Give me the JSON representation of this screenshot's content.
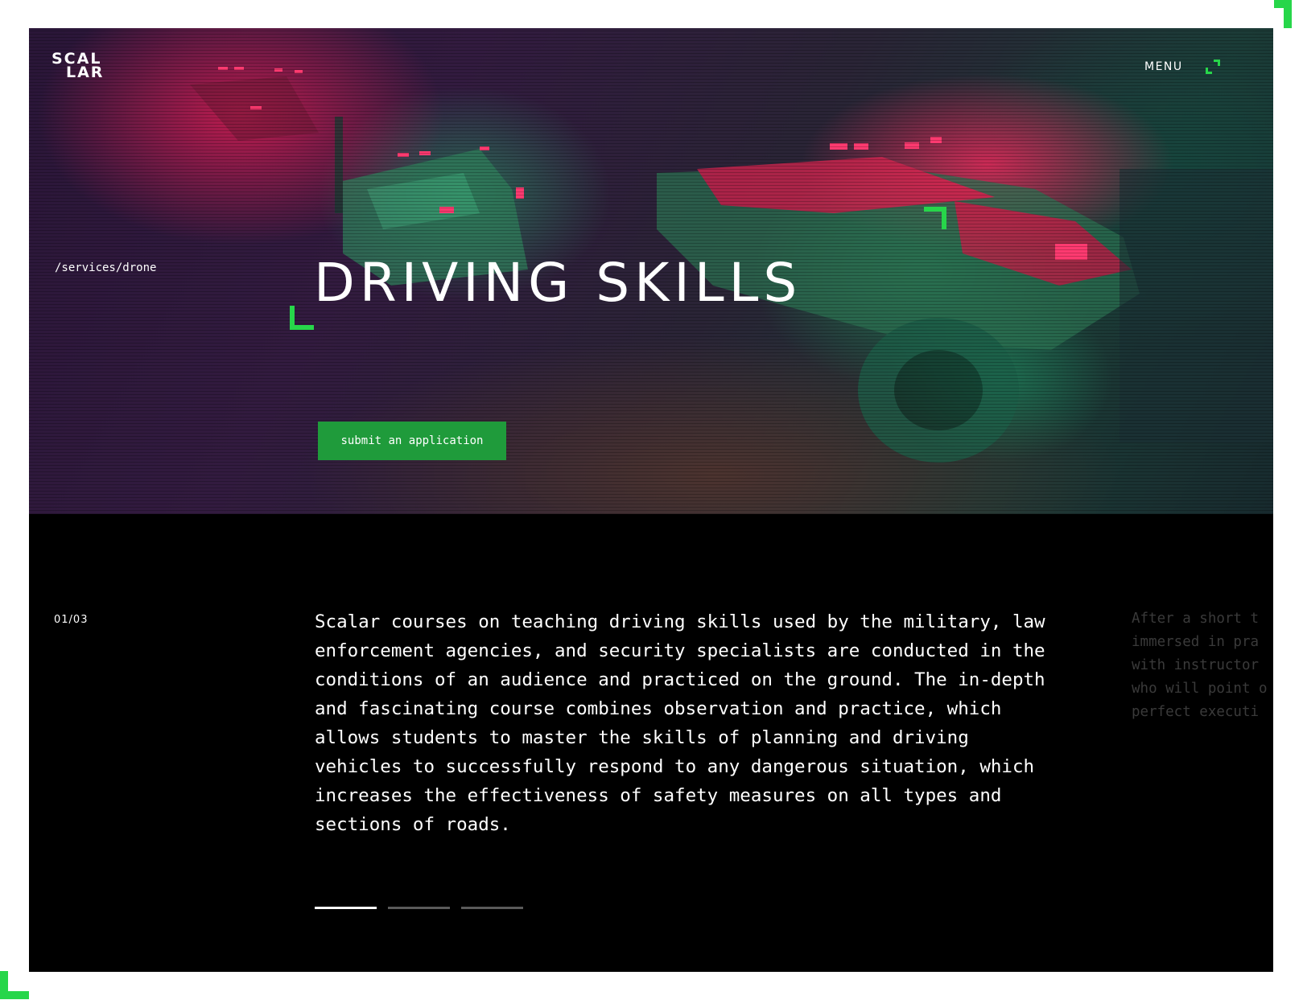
{
  "header": {
    "logo_line1": "SCAL",
    "logo_line2": "LAR",
    "menu_label": "MENU"
  },
  "hero": {
    "breadcrumb": "/services/drone",
    "title": "DRIVING SKILLS",
    "cta_label": "submit an application"
  },
  "content": {
    "counter": "01/03",
    "description": "Scalar courses on teaching driving skills used by the military, law enforcement agencies, and security specialists are conducted in the conditions of an audience and practiced on the ground. The in-depth and fascinating course combines observation and practice, which allows students to master the skills of planning and driving vehicles to successfully respond to any dangerous situation, which increases the effectiveness of safety measures on all types and sections of roads.",
    "next_preview": "After a short t\nimmersed in pra\nwith instructor\nwho will point o\nperfect executi"
  },
  "pagination": {
    "total": 3,
    "active_index": 0
  },
  "colors": {
    "accent_green": "#27d64a",
    "button_green": "#1f9b3b",
    "hero_red": "#e8285a",
    "hero_teal": "#247850"
  },
  "icons": {
    "menu": "menu-corner-icon",
    "bracket": "corner-bracket-icon"
  }
}
